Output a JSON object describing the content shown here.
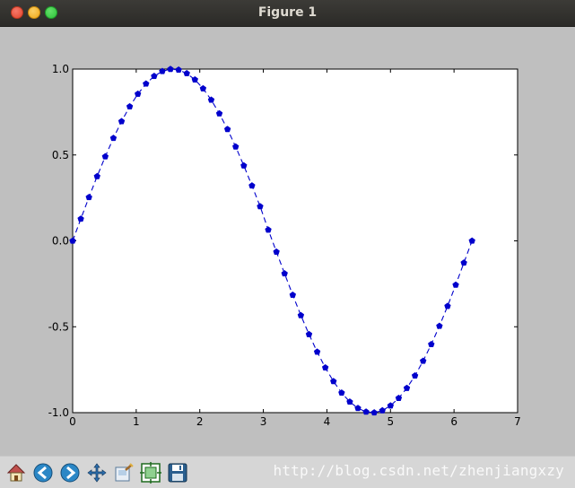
{
  "window": {
    "title": "Figure 1"
  },
  "toolbar": {
    "buttons": [
      {
        "icon": "home-icon"
      },
      {
        "icon": "back-icon"
      },
      {
        "icon": "forward-icon"
      },
      {
        "icon": "pan-icon"
      },
      {
        "icon": "zoom-icon"
      },
      {
        "icon": "configure-subplots-icon"
      },
      {
        "icon": "save-icon"
      }
    ],
    "watermark": "http://blog.csdn.net/zhenjiangxzy"
  },
  "colors": {
    "line": "#0000cc",
    "background": "#bfbfbf",
    "axes_bg": "#ffffff"
  },
  "chart_data": {
    "type": "line",
    "title": "",
    "xlabel": "",
    "ylabel": "",
    "xlim": [
      0,
      7
    ],
    "ylim": [
      -1.0,
      1.0
    ],
    "xticks": [
      0,
      1,
      2,
      3,
      4,
      5,
      6,
      7
    ],
    "yticks": [
      -1.0,
      -0.5,
      0.0,
      0.5,
      1.0
    ],
    "ytick_labels": [
      "-1.0",
      "-0.5",
      "0.0",
      "0.5",
      "1.0"
    ],
    "grid": false,
    "series": [
      {
        "style": "dashed",
        "marker": "pentagon",
        "color": "#0000cc",
        "x": [
          0.0,
          0.1282,
          0.2565,
          0.3847,
          0.5129,
          0.6411,
          0.7694,
          0.8976,
          1.0258,
          1.1541,
          1.2823,
          1.4105,
          1.5387,
          1.667,
          1.7952,
          1.9234,
          2.0517,
          2.1799,
          2.3081,
          2.4363,
          2.5646,
          2.6928,
          2.821,
          2.9493,
          3.0775,
          3.2057,
          3.3339,
          3.4622,
          3.5904,
          3.7186,
          3.8468,
          3.9751,
          4.1033,
          4.2315,
          4.3598,
          4.488,
          4.6162,
          4.7444,
          4.8727,
          5.0009,
          5.1291,
          5.2574,
          5.3856,
          5.5138,
          5.642,
          5.7703,
          5.8985,
          6.0267,
          6.155,
          6.2832
        ],
        "y": [
          0.0,
          0.1279,
          0.2537,
          0.3753,
          0.4907,
          0.5981,
          0.6956,
          0.7818,
          0.8551,
          0.9144,
          0.9587,
          0.9872,
          0.9995,
          0.9954,
          0.9749,
          0.9384,
          0.8866,
          0.8204,
          0.7409,
          0.6495,
          0.5479,
          0.4378,
          0.3212,
          0.2004,
          0.0641,
          -0.0641,
          -0.1904,
          -0.315,
          -0.4338,
          -0.5442,
          -0.6463,
          -0.738,
          -0.8178,
          -0.8847,
          -0.937,
          -0.9741,
          -0.9952,
          -0.9998,
          -0.9877,
          -0.9595,
          -0.9156,
          -0.8572,
          -0.7849,
          -0.6993,
          -0.6022,
          -0.4959,
          -0.38,
          -0.2564,
          -0.1277,
          0.0
        ]
      }
    ]
  }
}
